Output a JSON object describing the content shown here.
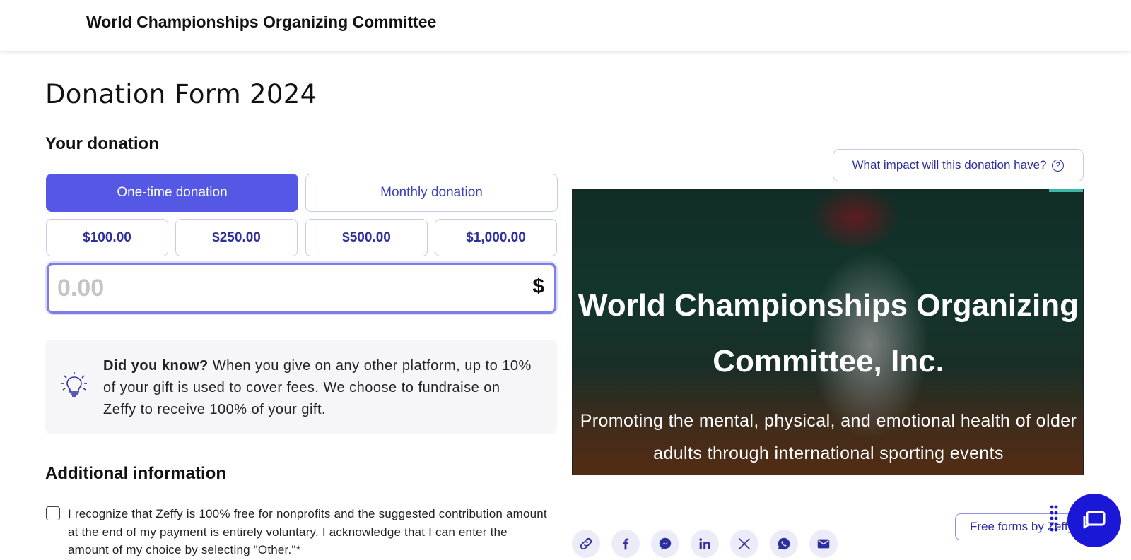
{
  "header": {
    "org_name": "World Championships Organizing Committee"
  },
  "form": {
    "title": "Donation Form 2024",
    "donation_section_title": "Your donation",
    "frequency": {
      "one_time": "One-time donation",
      "monthly": "Monthly donation",
      "selected": "One-time donation"
    },
    "amounts": [
      "$100.00",
      "$250.00",
      "$500.00",
      "$1,000.00"
    ],
    "amount_input": {
      "placeholder": "0.00",
      "currency": "$"
    },
    "tip": {
      "bold": "Did you know?",
      "text": " When you give on any other platform, up to 10% of your gift is used to cover fees. We choose to fundraise on Zeffy to receive 100% of your gift."
    },
    "additional_section_title": "Additional information",
    "consent": {
      "text": "I recognize that Zeffy is 100% free for nonprofits and the suggested contribution amount at the end of my payment is entirely voluntary. I acknowledge that I can enter the amount of my choice by selecting \"Other.\"*",
      "checked": false
    }
  },
  "sidebar": {
    "impact_button": "What impact will this donation have?",
    "help_glyph": "?",
    "hero": {
      "title": "World Championships Organizing Committee, Inc.",
      "subtitle": "Promoting the mental, physical, and emotional health of older adults through international sporting events"
    },
    "share_icons": [
      "link-icon",
      "facebook-icon",
      "messenger-icon",
      "linkedin-icon",
      "x-icon",
      "whatsapp-icon",
      "email-icon"
    ],
    "free_forms_label": "Free forms by Zeffy"
  },
  "colors": {
    "primary": "#5458e5",
    "primary_text": "#2e2f9e",
    "chat": "#1a17d6"
  }
}
